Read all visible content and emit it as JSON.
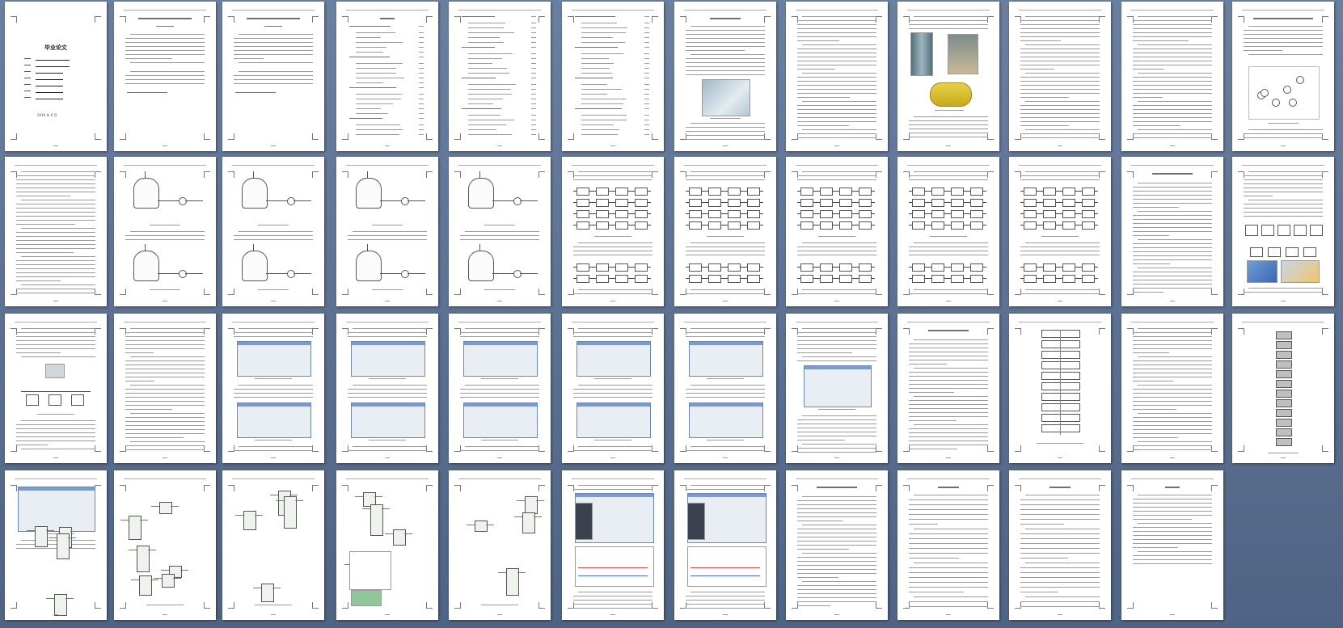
{
  "viewer": {
    "columns": 12,
    "rows": 4,
    "page_count": 47
  },
  "cover": {
    "title": "毕业论文",
    "date": "2016 年 6 月"
  }
}
